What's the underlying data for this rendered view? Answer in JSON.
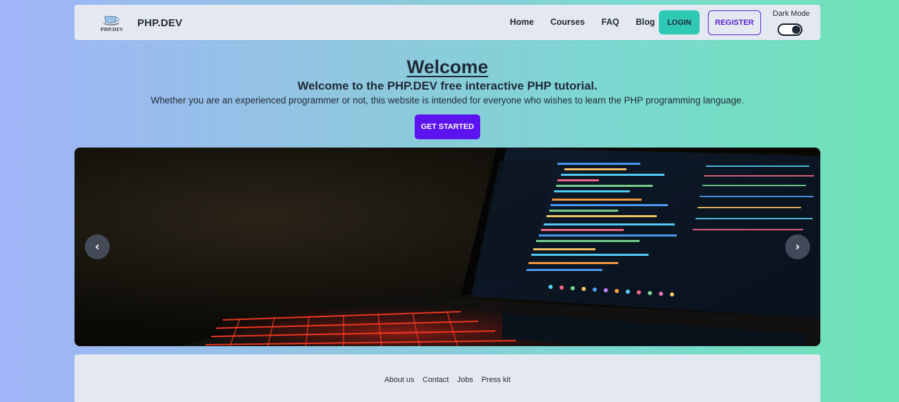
{
  "header": {
    "brand": "PHP.DEV",
    "logo_text": "PHP.DEV",
    "nav": [
      {
        "label": "Home"
      },
      {
        "label": "Courses"
      },
      {
        "label": "FAQ"
      },
      {
        "label": "Blog"
      }
    ],
    "login_label": "LOGIN",
    "register_label": "REGISTER",
    "dark_mode_label": "Dark Mode",
    "dark_mode_on": true
  },
  "hero": {
    "title": "Welcome",
    "subtitle": "Welcome to the PHP.DEV free interactive PHP tutorial.",
    "description": "Whether you are an experienced programmer or not, this website is intended for everyone who wishes to learn the PHP programming language.",
    "cta_label": "GET STARTED"
  },
  "carousel": {
    "prev_icon": "‹",
    "next_icon": "›",
    "image_subject": "laptop with code editor and red backlit keyboard"
  },
  "footer": {
    "links": [
      {
        "label": "About us"
      },
      {
        "label": "Contact"
      },
      {
        "label": "Jobs"
      },
      {
        "label": "Press kit"
      }
    ]
  },
  "colors": {
    "accent_teal": "#2ec8b3",
    "accent_purple": "#5b14f0",
    "panel_bg": "#e4e9f1"
  }
}
